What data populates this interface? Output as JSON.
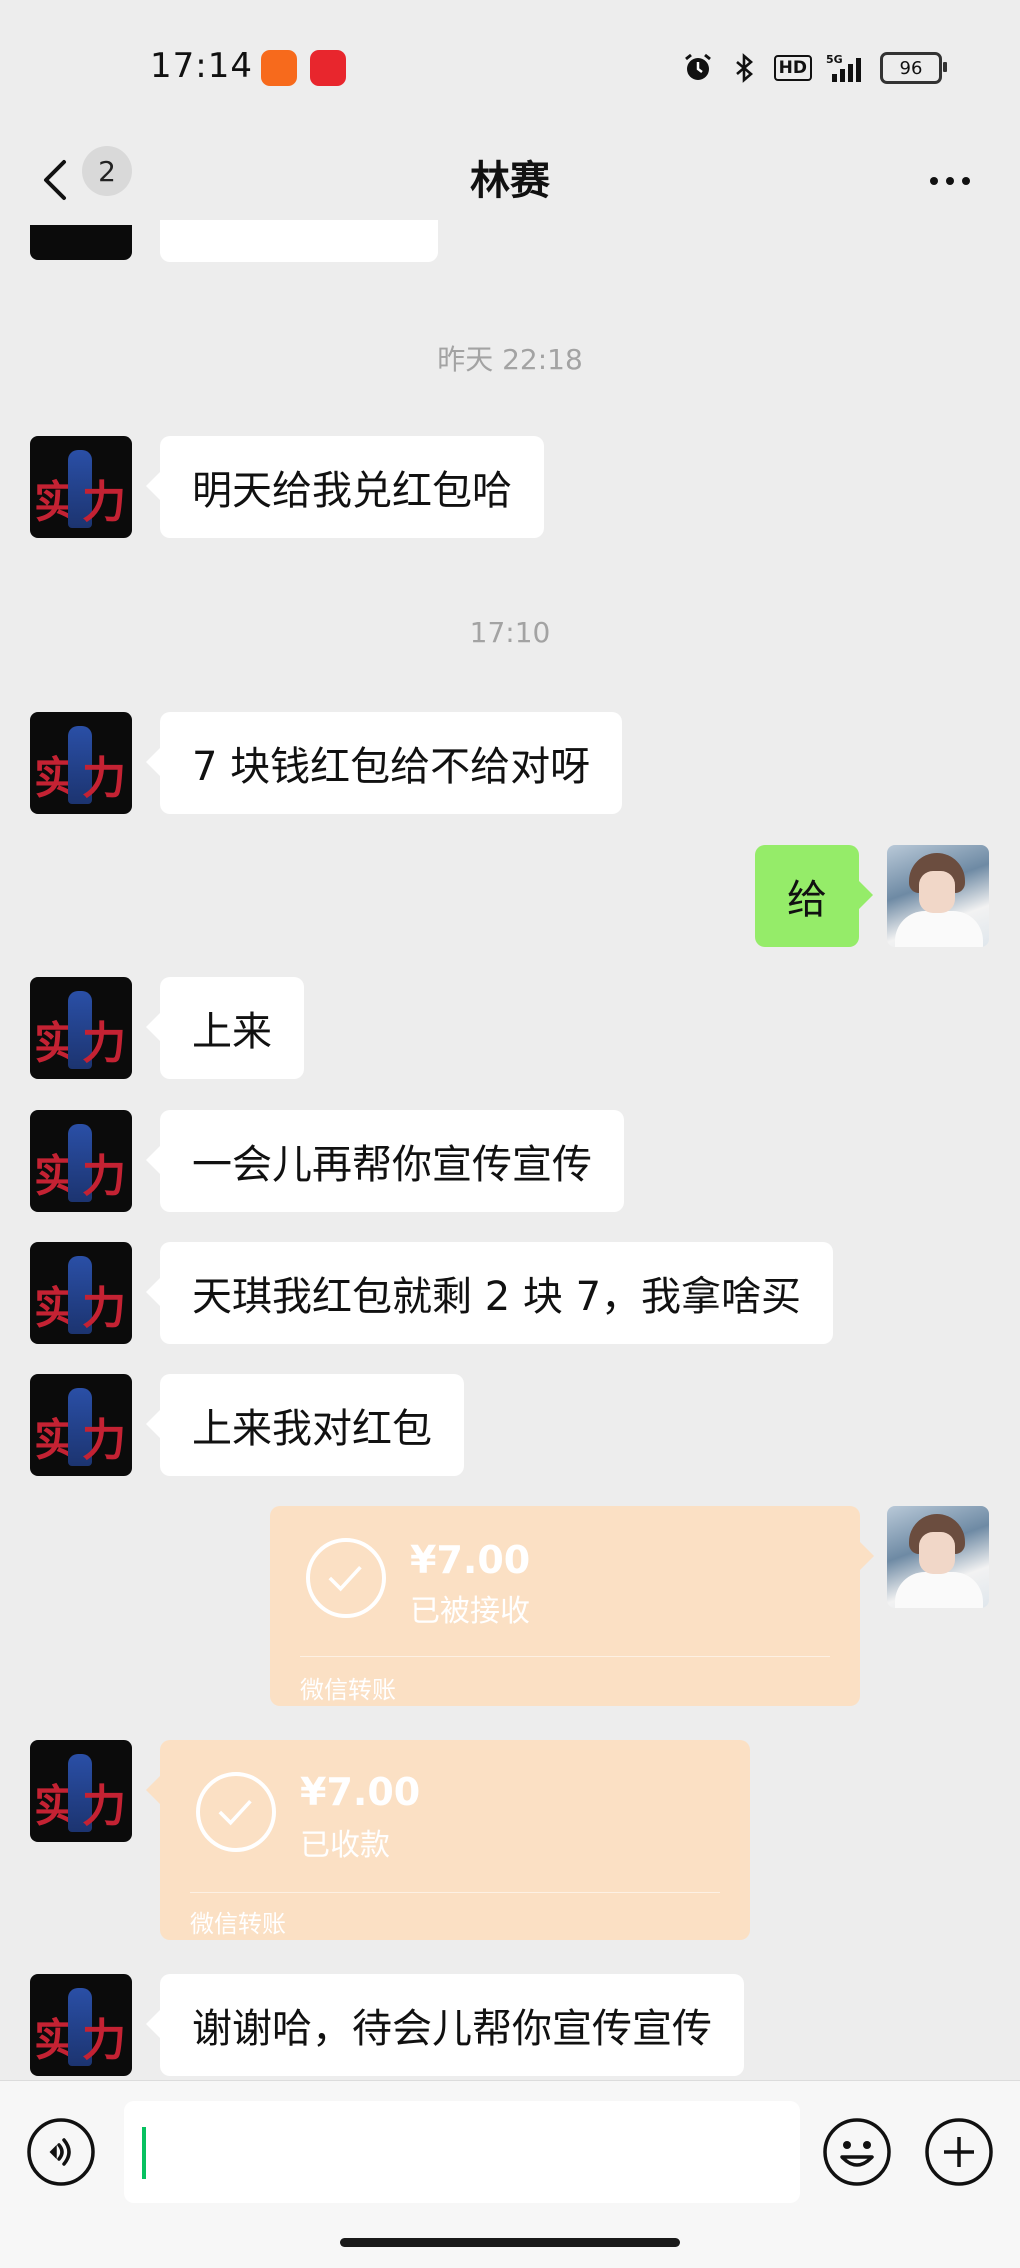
{
  "status_bar": {
    "time": "17:14",
    "network": "5G",
    "battery": "96",
    "hd_label": "HD",
    "icons": [
      "alarm-icon",
      "bluetooth-icon",
      "hd-icon",
      "signal-icon",
      "battery-icon"
    ]
  },
  "nav": {
    "title": "林赛",
    "unread_count": "2",
    "icons": [
      "back-arrow-icon",
      "more-icon"
    ]
  },
  "timestamps": [
    "昨天 22:18",
    "17:10"
  ],
  "messages": [
    {
      "side": "left",
      "text": "明天给我兑红包哈"
    },
    {
      "side": "left",
      "text": "7 块钱红包给不给对呀"
    },
    {
      "side": "right",
      "text": "给"
    },
    {
      "side": "left",
      "text": "上来"
    },
    {
      "side": "left",
      "text": "一会儿再帮你宣传宣传"
    },
    {
      "side": "left",
      "text": "天琪我红包就剩 2 块 7，我拿啥买"
    },
    {
      "side": "left",
      "text": "上来我对红包"
    },
    {
      "side": "left",
      "text": "谢谢哈，待会儿帮你宣传宣传"
    }
  ],
  "transfers": [
    {
      "side": "right",
      "amount": "¥7.00",
      "status": "已被接收",
      "footer": "微信转账"
    },
    {
      "side": "left",
      "amount": "¥7.00",
      "status": "已收款",
      "footer": "微信转账"
    }
  ],
  "avatar_left_text": [
    "实",
    "力"
  ],
  "input": {
    "value": "",
    "placeholder": ""
  },
  "colors": {
    "background": "#ededed",
    "bubble_out": "#95ec69",
    "bubble_in": "#ffffff",
    "transfer": "#fbe0c4",
    "caret": "#07c160"
  }
}
